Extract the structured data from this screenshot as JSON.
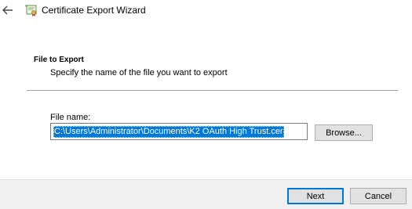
{
  "window": {
    "title": "Certificate Export Wizard",
    "back_icon": "back-arrow-icon",
    "app_icon": "certificate-icon"
  },
  "header": {
    "title": "File to Export",
    "description": "Specify the name of the file you want to export"
  },
  "form": {
    "file_name_label": "File name:",
    "file_name_value": "C:\\Users\\Administrator\\Documents\\K2 OAuth High Trust.cer",
    "browse_label": "Browse..."
  },
  "footer": {
    "next_label": "Next",
    "cancel_label": "Cancel"
  },
  "colors": {
    "accent": "#0078d7",
    "button_face": "#e1e1e1",
    "footer_bg": "#f0f0f0"
  }
}
